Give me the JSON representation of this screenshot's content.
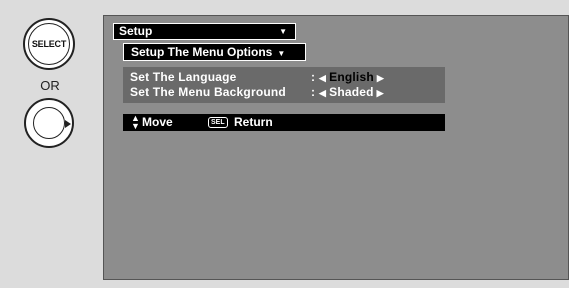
{
  "remote": {
    "select_label": "SELECT",
    "or_text": "OR"
  },
  "menu": {
    "title": "Setup",
    "title_dropdown_icon": "▼",
    "submenu": "Setup The Menu Options",
    "submenu_dropdown_icon": "▼",
    "options": [
      {
        "label": "Set The Language",
        "colon": ":",
        "value": "English",
        "highlighted": true
      },
      {
        "label": "Set The Menu Background",
        "colon": ":",
        "value": "Shaded",
        "highlighted": false
      }
    ],
    "footer": {
      "move_icon": "▲▼",
      "move_label": "Move",
      "sel_icon": "SEL",
      "return_label": "Return"
    }
  },
  "colors": {
    "page_bg": "#dcdcdc",
    "screen_bg": "#8d8d8d",
    "options_bg": "#6a6a6a",
    "bar_bg": "#000000",
    "text": "#ffffff"
  }
}
